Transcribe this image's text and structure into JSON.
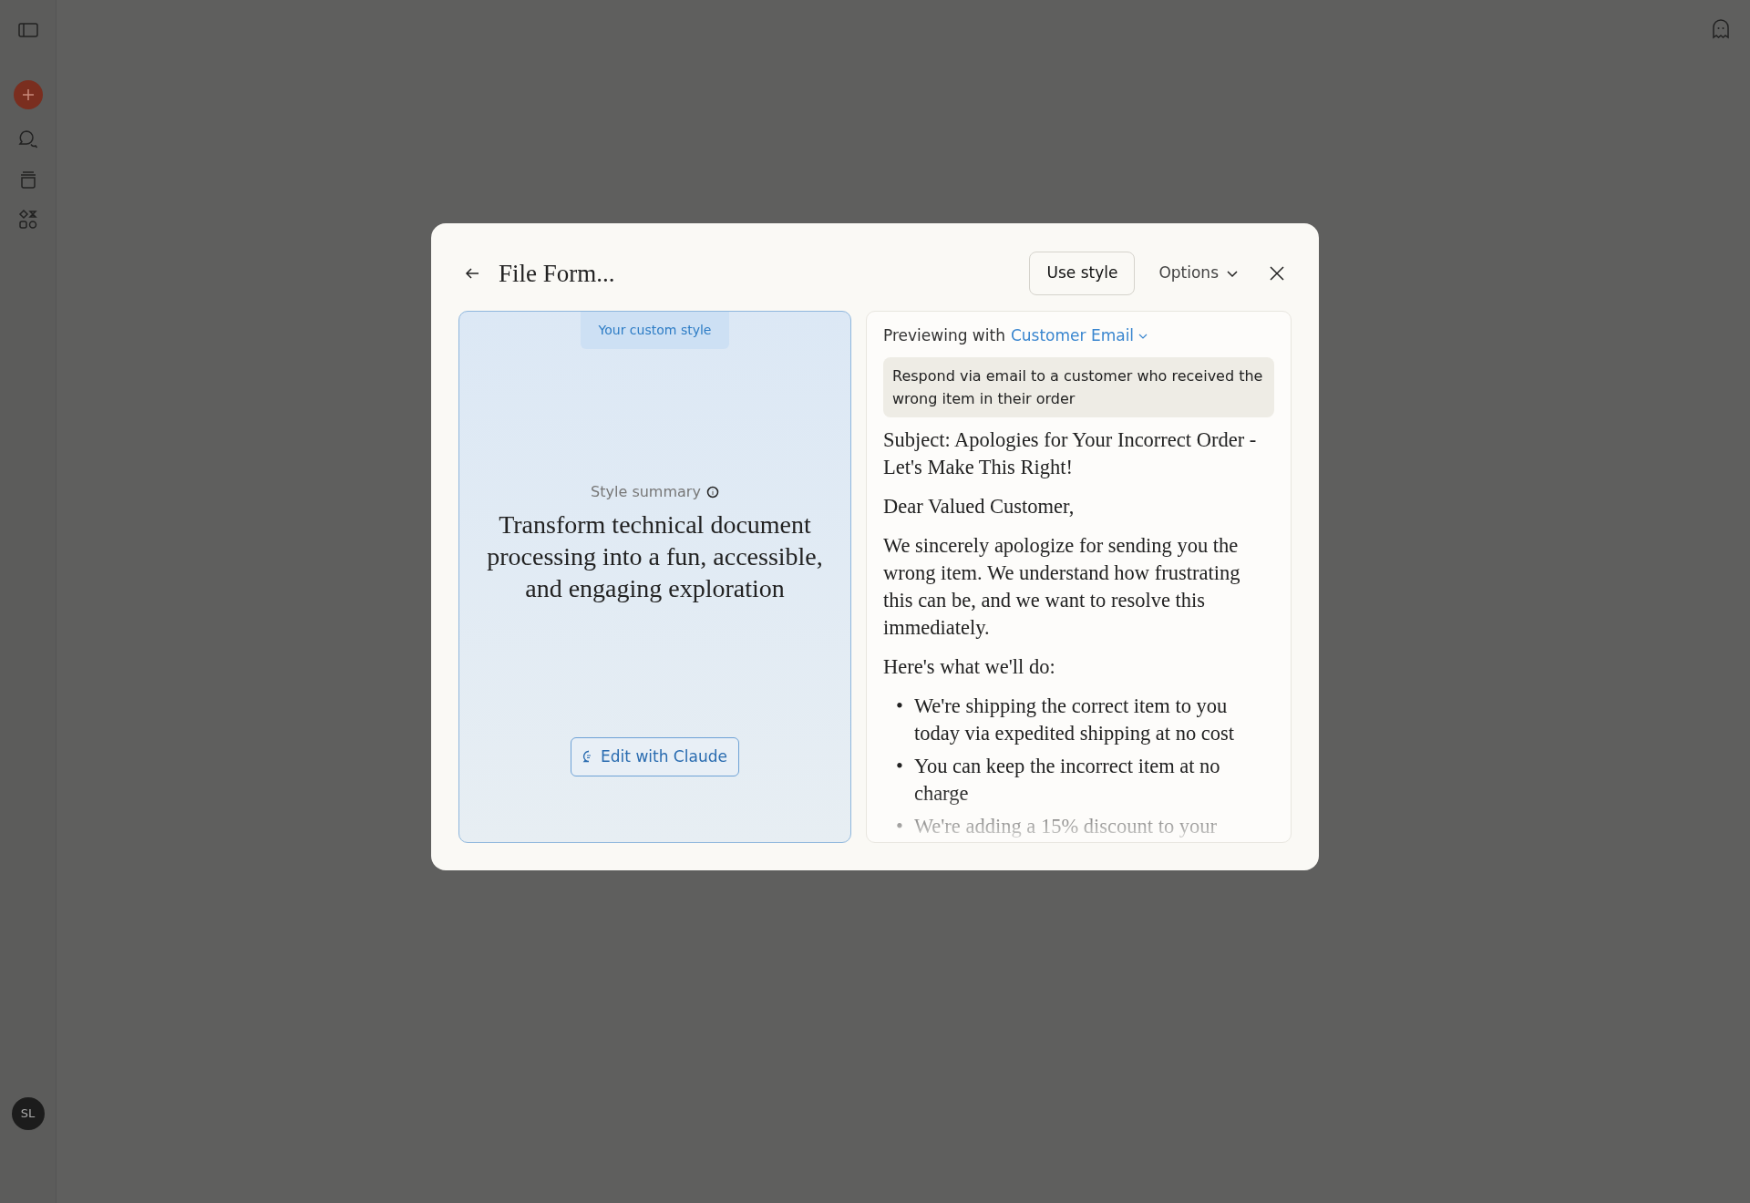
{
  "sidebar": {
    "user_initials": "SL"
  },
  "modal": {
    "title": "File Form...",
    "use_style_button": "Use style",
    "options_button": "Options",
    "style_panel": {
      "badge": "Your custom style",
      "summary_label": "Style summary",
      "summary": "Transform technical document processing into a fun, accessible, and engaging exploration",
      "edit_button": "Edit with Claude"
    },
    "preview_panel": {
      "label": "Previewing with",
      "selector": "Customer Email",
      "prompt": "Respond via email to a customer who received the wrong item in their order",
      "blocks": [
        {
          "kind": "paragraph",
          "text": "Subject: Apologies for Your Incorrect Order - Let's Make This Right!"
        },
        {
          "kind": "paragraph",
          "text": "Dear Valued Customer,"
        },
        {
          "kind": "paragraph",
          "text": "We sincerely apologize for sending you the wrong item. We understand how frustrating this can be, and we want to resolve this immediately."
        },
        {
          "kind": "paragraph",
          "text": "Here's what we'll do:"
        },
        {
          "kind": "bullets",
          "marker": "•",
          "items": [
            "We're shipping the correct item to you today via expedited shipping at no cost",
            "You can keep the incorrect item at no charge",
            "We're adding a 15% discount to your"
          ]
        }
      ]
    }
  }
}
